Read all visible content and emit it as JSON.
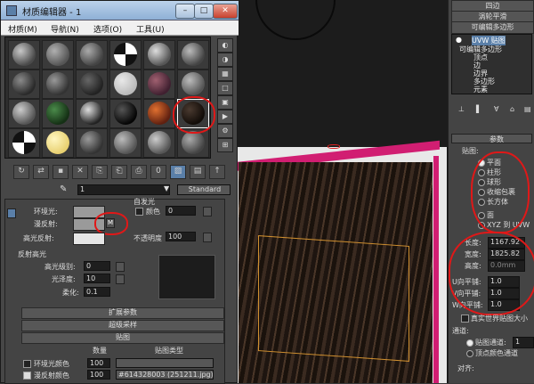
{
  "window": {
    "title": "材质编辑器 - 1",
    "menu": [
      "材质(M)",
      "导航(N)",
      "选项(O)",
      "工具(U)"
    ]
  },
  "name_field": {
    "value": "1",
    "type_button": "Standard"
  },
  "toolbar": {
    "zero_label": "0"
  },
  "basic_params": {
    "ambient_label": "环境光:",
    "diffuse_label": "漫反射:",
    "specular_label": "高光反射:",
    "map_button": "M",
    "self_illum_group": "自发光",
    "color_label": "颜色",
    "color_value": "0",
    "opacity_label": "不透明度",
    "opacity_value": "100"
  },
  "specular_highlights": {
    "header": "反射高光",
    "level_label": "高光级别:",
    "level_value": "0",
    "gloss_label": "光泽度:",
    "gloss_value": "10",
    "soften_label": "柔化:",
    "soften_value": "0.1"
  },
  "rollouts": {
    "extended": "扩展参数",
    "supersampling": "超级采样",
    "maps": "贴图"
  },
  "maps": {
    "amount_header": "数量",
    "maptype_header": "贴图类型",
    "rows": [
      {
        "label": "环境光颜色",
        "amount": "100",
        "map": "",
        "checked": false
      },
      {
        "label": "漫反射颜色",
        "amount": "100",
        "map": "#614328003 (251211.jpg)",
        "checked": true
      }
    ]
  },
  "command_panel": {
    "top_buttons": [
      "四边",
      "涡轮平滑",
      "可编辑多边形"
    ],
    "stack": [
      "UVW 贴图",
      "可编辑多边形",
      "顶点",
      "边",
      "边界",
      "多边形",
      "元素"
    ],
    "params_header": "参数",
    "mapping_label": "贴图:",
    "mapping_options": [
      "平面",
      "柱形",
      "球形",
      "收缩包裹",
      "长方体",
      "面",
      "XYZ 到 UVW"
    ],
    "mapping_selected": 0,
    "length_label": "长度:",
    "length_value": "1167.92",
    "width_label": "宽度:",
    "width_value": "1825.82",
    "height_label": "高度:",
    "height_value": "0.0mm",
    "u_tile_label": "U向平铺:",
    "u_tile_value": "1.0",
    "v_tile_label": "V向平铺:",
    "v_tile_value": "1.0",
    "w_tile_label": "W向平铺:",
    "w_tile_value": "1.0",
    "real_world_label": "真实世界贴图大小",
    "channel_header": "通道:",
    "map_channel_label": "贴图通道:",
    "map_channel_value": "1",
    "vertex_color_label": "顶点颜色通道",
    "alignment_label": "对齐:"
  },
  "colors": {
    "accent_red": "#e01818",
    "viewport_pink": "#d11e72"
  }
}
